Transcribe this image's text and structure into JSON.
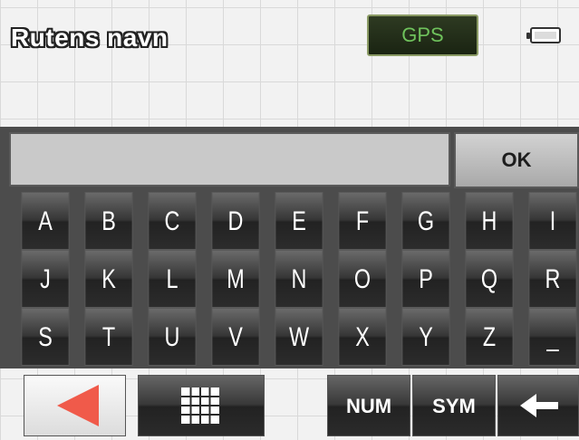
{
  "header": {
    "title": "Rutens navn",
    "gps_label": "GPS",
    "battery_icon": "battery-icon"
  },
  "input": {
    "value": ""
  },
  "ok_label": "OK",
  "rows": [
    [
      "A",
      "B",
      "C",
      "D",
      "E",
      "F",
      "G",
      "H",
      "I"
    ],
    [
      "J",
      "K",
      "L",
      "M",
      "N",
      "O",
      "P",
      "Q",
      "R"
    ],
    [
      "S",
      "T",
      "U",
      "V",
      "W",
      "X",
      "Y",
      "Z",
      "_"
    ]
  ],
  "bottom": {
    "back_icon": "back-arrow-icon",
    "grid_icon": "grid-icon",
    "num_label": "NUM",
    "sym_label": "SYM",
    "backspace_icon": "backspace-icon"
  },
  "colors": {
    "gps_text": "#6fc25c",
    "back_arrow": "#f05a4a",
    "keyboard_bg": "#4c4c4c"
  }
}
